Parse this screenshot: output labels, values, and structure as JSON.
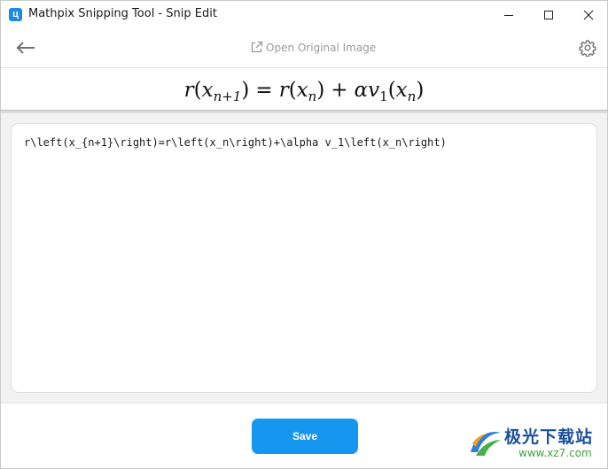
{
  "window": {
    "title": "Mathpix Snipping Tool - Snip Edit",
    "app_icon_glyph": "ц",
    "controls": [
      "minimize-icon",
      "maximize-icon",
      "close-icon"
    ]
  },
  "toolbar": {
    "back_icon": "arrow-left-icon",
    "open_original_label": "Open Original Image",
    "open_original_icon": "external-link-icon",
    "settings_icon": "gear-icon"
  },
  "formula": {
    "latex_rendered": "r(x_{n+1}) = r(x_n) + α v_1(x_n)",
    "parts": {
      "r": "r",
      "x": "x",
      "sub_n1": "n+1",
      "sub_n": "n",
      "equals": "=",
      "plus": "+",
      "alpha": "α",
      "v": "v",
      "sub_1": "1",
      "lparen": "(",
      "rparen": ")"
    }
  },
  "editor": {
    "latex_source": "r\\left(x_{n+1}\\right)=r\\left(x_n\\right)+\\alpha v_1\\left(x_n\\right)"
  },
  "footer": {
    "save_label": "Save",
    "accent_color": "#1597f0"
  },
  "watermark": {
    "brand_text": "极光下载站",
    "url_text": "www.xz7.com"
  }
}
